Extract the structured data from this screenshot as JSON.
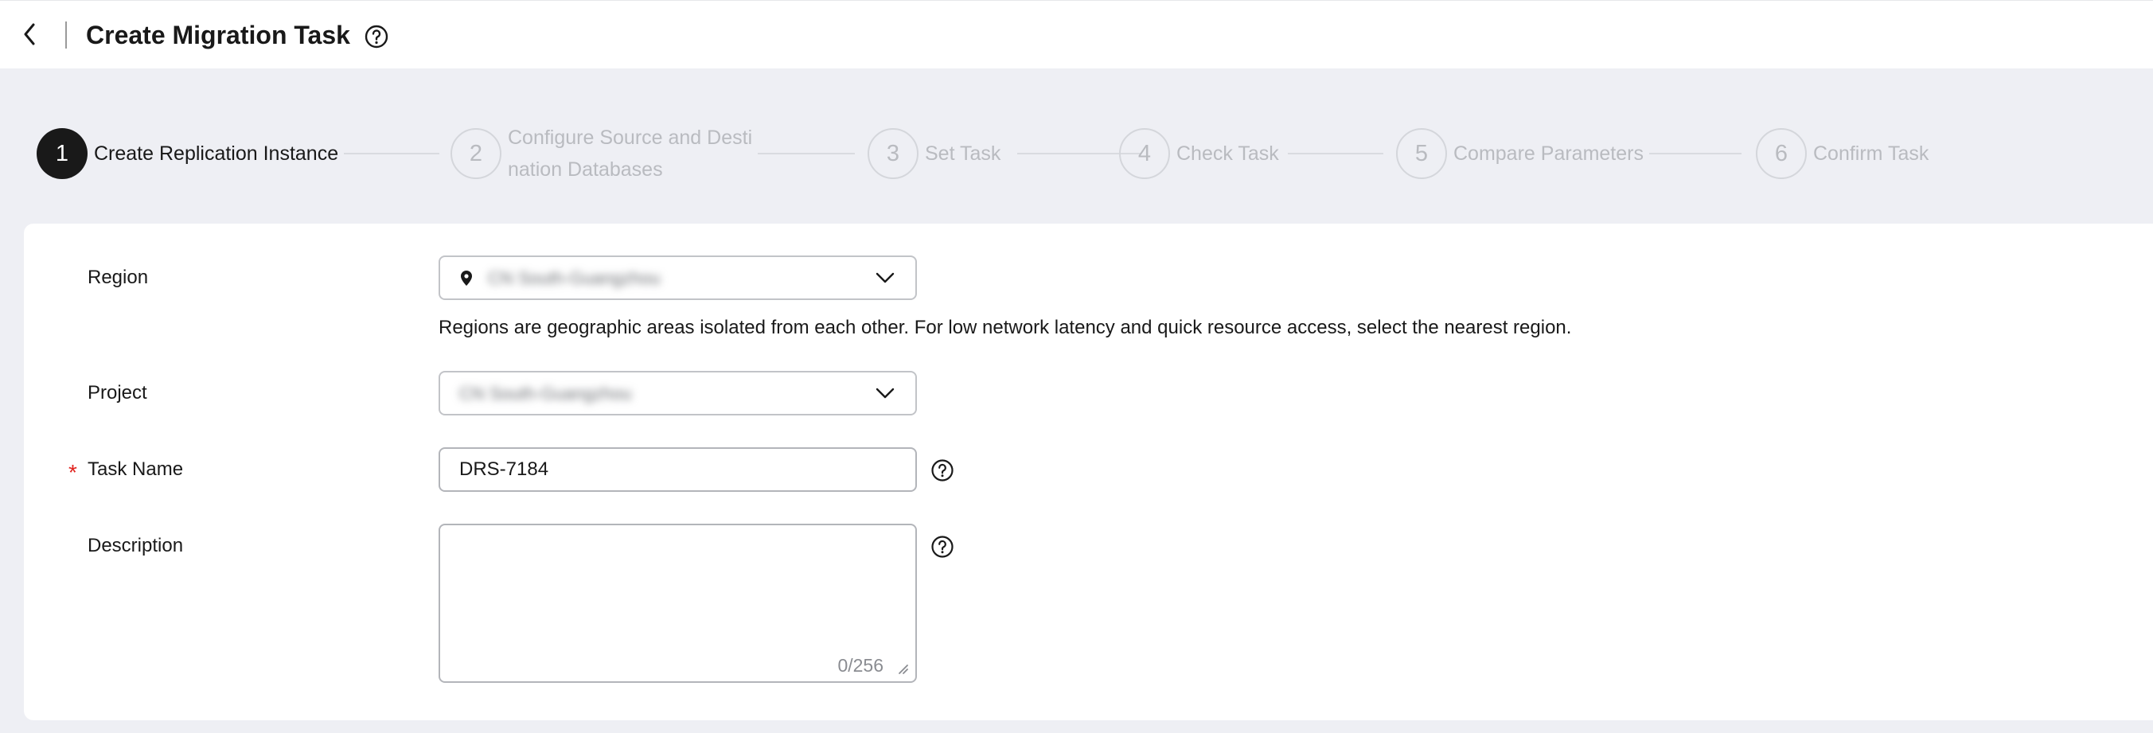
{
  "header": {
    "title": "Create Migration Task"
  },
  "steps": [
    {
      "number": "1",
      "label": "Create Replication Instance",
      "state": "active"
    },
    {
      "number": "2",
      "label_line1": "Configure Source and Desti",
      "label_line2": "nation Databases",
      "state": "inactive"
    },
    {
      "number": "3",
      "label": "Set Task",
      "state": "inactive"
    },
    {
      "number": "4",
      "label": "Check Task",
      "state": "inactive"
    },
    {
      "number": "5",
      "label": "Compare Parameters",
      "state": "inactive"
    },
    {
      "number": "6",
      "label": "Confirm Task",
      "state": "inactive"
    }
  ],
  "form": {
    "region": {
      "label": "Region",
      "value": "CN South-Guangzhou",
      "hint": "Regions are geographic areas isolated from each other. For low network latency and quick resource access, select the nearest region."
    },
    "project": {
      "label": "Project",
      "value": "CN South-Guangzhou"
    },
    "task_name": {
      "label": "Task Name",
      "required_mark": "*",
      "value": "DRS-7184"
    },
    "description": {
      "label": "Description",
      "value": "",
      "counter": "0/256"
    }
  },
  "colors": {
    "active_step": "#191919",
    "inactive_step": "#b9bbc0",
    "required": "#e1231e",
    "page_bg": "#eeeff4"
  },
  "icons": {
    "back": "chevron-left-icon",
    "help": "question-circle-icon",
    "location": "location-pin-icon",
    "dropdown": "chevron-down-icon",
    "resize": "resize-handle-icon"
  }
}
